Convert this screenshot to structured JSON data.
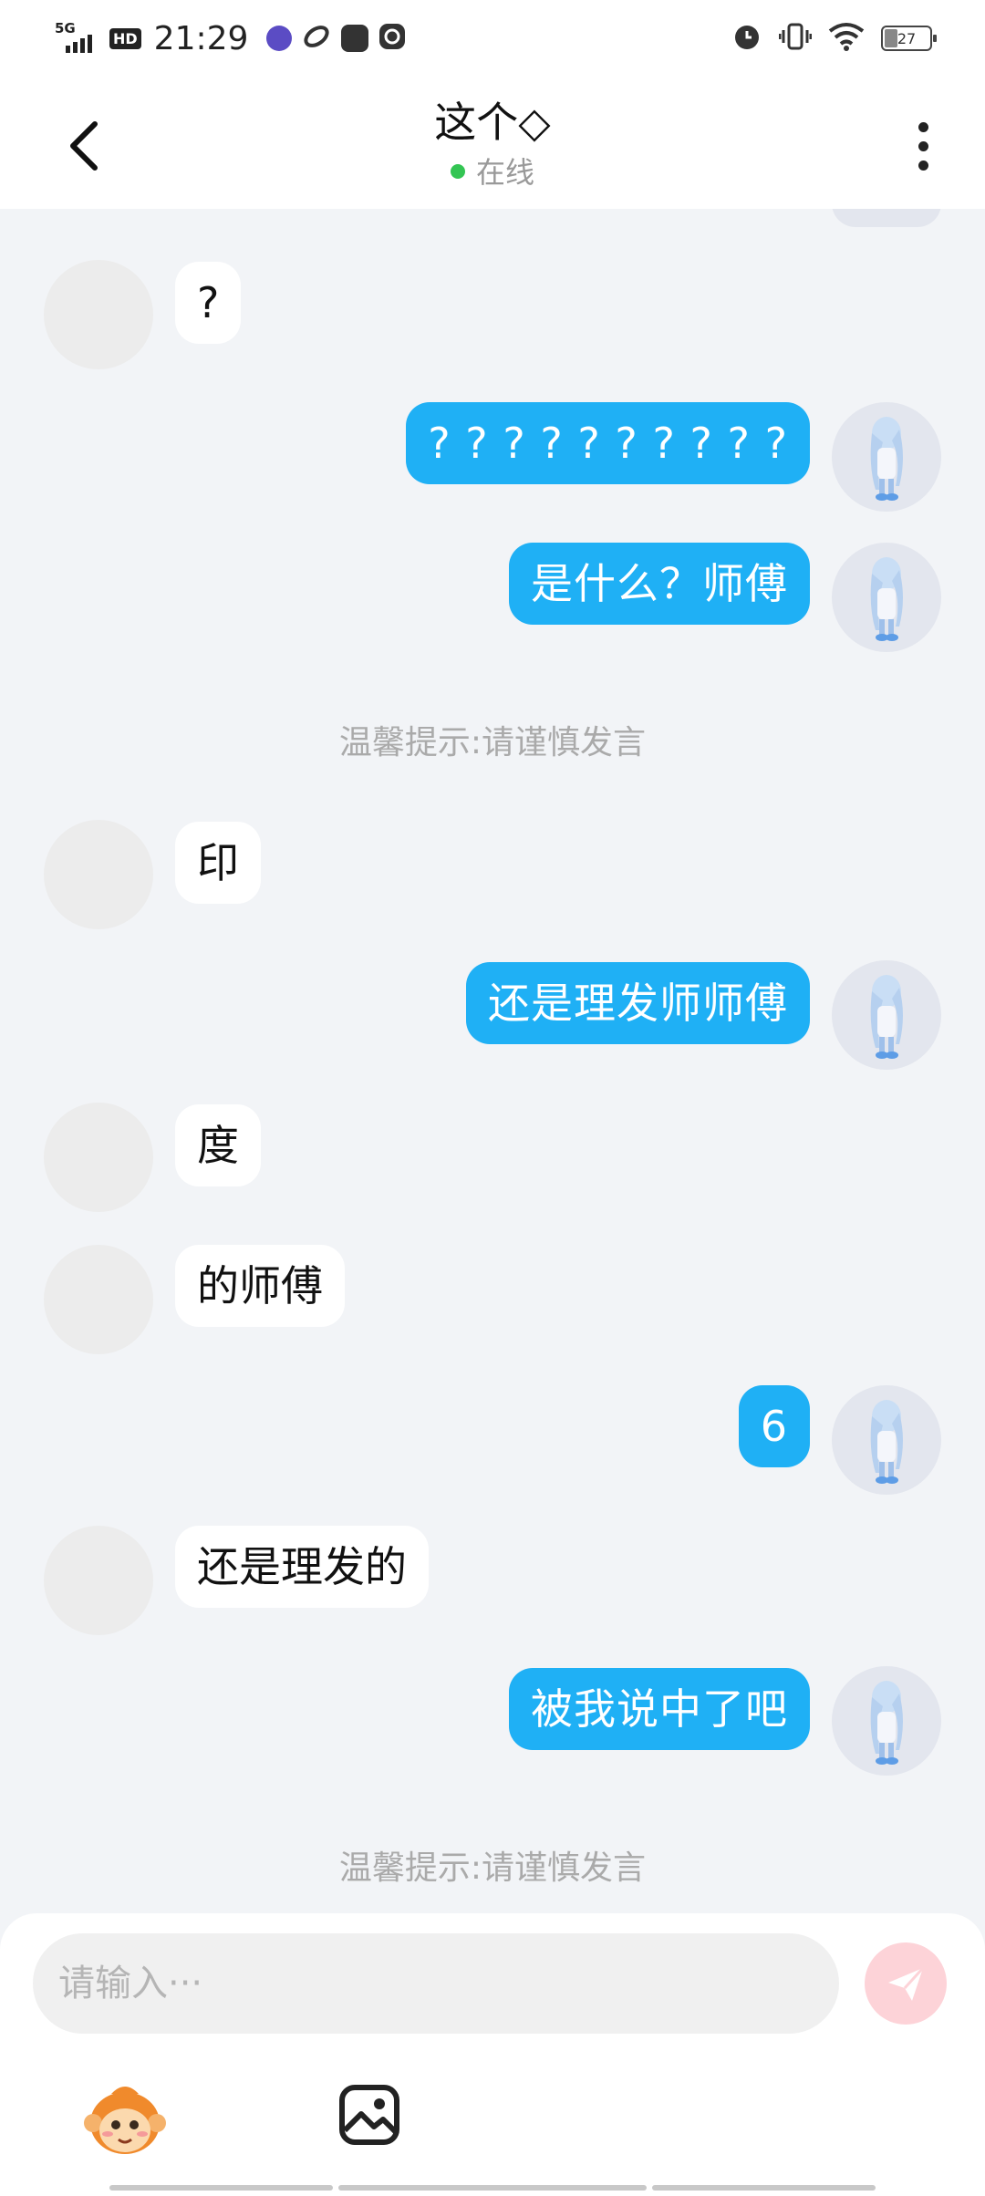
{
  "status_bar": {
    "network": "5G",
    "hd": "HD",
    "time": "21:29",
    "battery": "27"
  },
  "header": {
    "title": "这个◇",
    "status": "在线"
  },
  "chat": {
    "messages": [
      {
        "from": "peer",
        "text": "?"
      },
      {
        "from": "me",
        "text": "? ? ? ? ? ? ? ? ? ?"
      },
      {
        "from": "me",
        "text": "是什么？师傅"
      },
      {
        "from": "system",
        "text": "温馨提示:请谨慎发言"
      },
      {
        "from": "peer",
        "text": "印"
      },
      {
        "from": "me",
        "text": "还是理发师师傅"
      },
      {
        "from": "peer",
        "text": "度"
      },
      {
        "from": "peer",
        "text": "的师傅"
      },
      {
        "from": "me",
        "text": "6"
      },
      {
        "from": "peer",
        "text": "还是理发的"
      },
      {
        "from": "me",
        "text": "被我说中了吧"
      },
      {
        "from": "system",
        "text": "温馨提示:请谨慎发言"
      }
    ]
  },
  "input": {
    "placeholder": "请输入···"
  },
  "colors": {
    "my_bubble": "#1fb0f5",
    "peer_bubble": "#ffffff",
    "background": "#f2f4f7",
    "online_dot": "#33c553",
    "send_button": "#fdd3d8"
  },
  "icons": {
    "back": "chevron-left-icon",
    "more": "more-vertical-icon",
    "send": "send-icon",
    "emoji": "monkey-emoji-icon",
    "image": "image-icon"
  }
}
